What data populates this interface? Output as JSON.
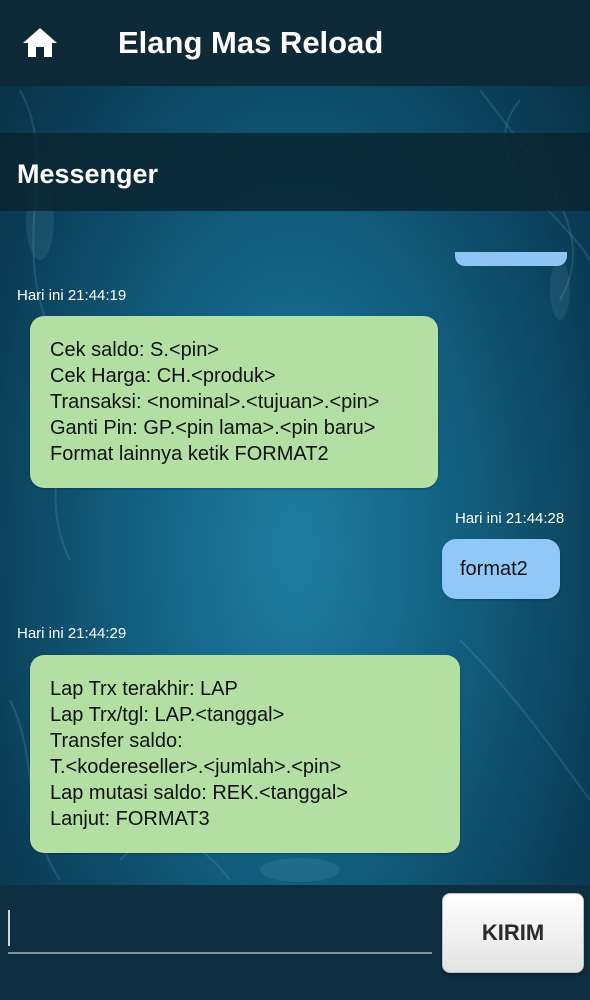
{
  "header": {
    "title": "Elang Mas Reload",
    "home_icon": "home-icon"
  },
  "section": {
    "title": "Messenger"
  },
  "messages": [
    {
      "direction": "incoming",
      "timestamp": "Hari ini 21:44:19",
      "lines": [
        "Cek saldo: S.<pin>",
        "Cek Harga: CH.<produk>",
        "Transaksi: <nominal>.<tujuan>.<pin>",
        "Ganti Pin: GP.<pin lama>.<pin baru>",
        "Format lainnya ketik FORMAT2"
      ]
    },
    {
      "direction": "outgoing",
      "timestamp": "Hari ini 21:44:28",
      "lines": [
        "format2"
      ]
    },
    {
      "direction": "incoming",
      "timestamp": "Hari ini 21:44:29",
      "lines": [
        "Lap Trx terakhir: LAP",
        "Lap Trx/tgl: LAP.<tanggal>",
        "Transfer saldo:",
        "T.<kodereseller>.<jumlah>.<pin>",
        "Lap mutasi saldo: REK.<tanggal>",
        "Lanjut: FORMAT3"
      ]
    }
  ],
  "composer": {
    "input_value": "",
    "send_label": "KIRIM"
  },
  "colors": {
    "incoming_bubble": "#b3dfa2",
    "outgoing_bubble": "#90c8f7",
    "topbar": "#0e2a38"
  }
}
